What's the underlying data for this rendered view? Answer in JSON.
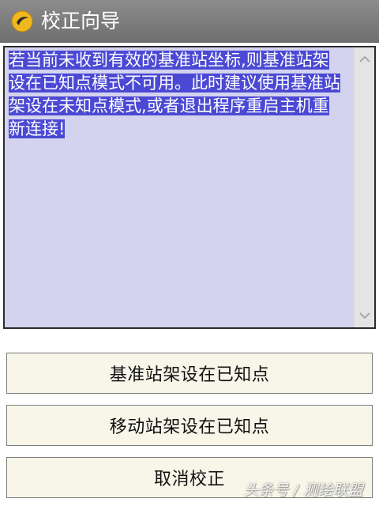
{
  "window": {
    "title": "校正向导",
    "icon": "app-logo-icon"
  },
  "message": {
    "text": "若当前未收到有效的基准站坐标,则基准站架设在已知点模式不可用。此时建议使用基准站架设在未知点模式,或者退出程序重启主机重新连接!"
  },
  "buttons": {
    "base_known": "基准站架设在已知点",
    "rover_known": "移动站架设在已知点",
    "cancel": "取消校正"
  },
  "watermark": "头条号 / 测绘联盟",
  "colors": {
    "titlebar": "#7d7d7d",
    "text_bg": "#d3d3ef",
    "selection": "#4b49d4",
    "button_bg": "#f7f6e9"
  }
}
